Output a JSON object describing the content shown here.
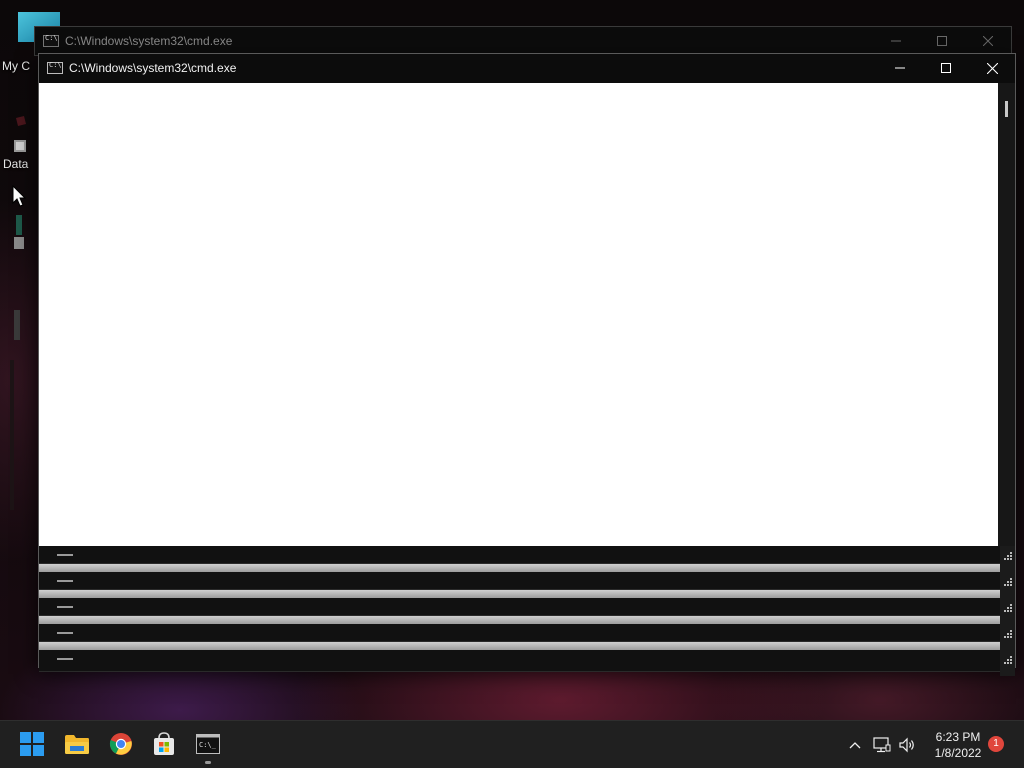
{
  "desktop": {
    "icons": [
      {
        "label": "My C",
        "icon": "this-pc-icon"
      },
      {
        "label": "Data",
        "icon": "data-file-icon"
      },
      {
        "label": "",
        "icon": "shortcut-icon"
      }
    ]
  },
  "windows": {
    "back": {
      "title": "C:\\Windows\\system32\\cmd.exe",
      "icon": "cmd-icon"
    },
    "front": {
      "title": "C:\\Windows\\system32\\cmd.exe",
      "icon": "cmd-icon"
    }
  },
  "caption_buttons": {
    "minimize": "minimize-icon",
    "maximize": "maximize-icon",
    "close": "close-icon"
  },
  "taskbar": {
    "apps": [
      {
        "name": "Start",
        "icon": "windows-start-icon"
      },
      {
        "name": "File Explorer",
        "icon": "folder-icon"
      },
      {
        "name": "Google Chrome",
        "icon": "chrome-icon"
      },
      {
        "name": "Microsoft Store",
        "icon": "store-icon"
      },
      {
        "name": "Command Prompt",
        "icon": "cmd-icon"
      }
    ],
    "tray": {
      "icons": [
        "chevron-up-icon",
        "network-icon",
        "volume-icon"
      ],
      "time": "6:23 PM",
      "date": "1/8/2022",
      "notification_count": "1"
    }
  },
  "colors": {
    "taskbar": "#202020",
    "console_bg": "#ffffff",
    "titlebar": "#0c0c0c",
    "notification_badge": "#e0463c"
  }
}
